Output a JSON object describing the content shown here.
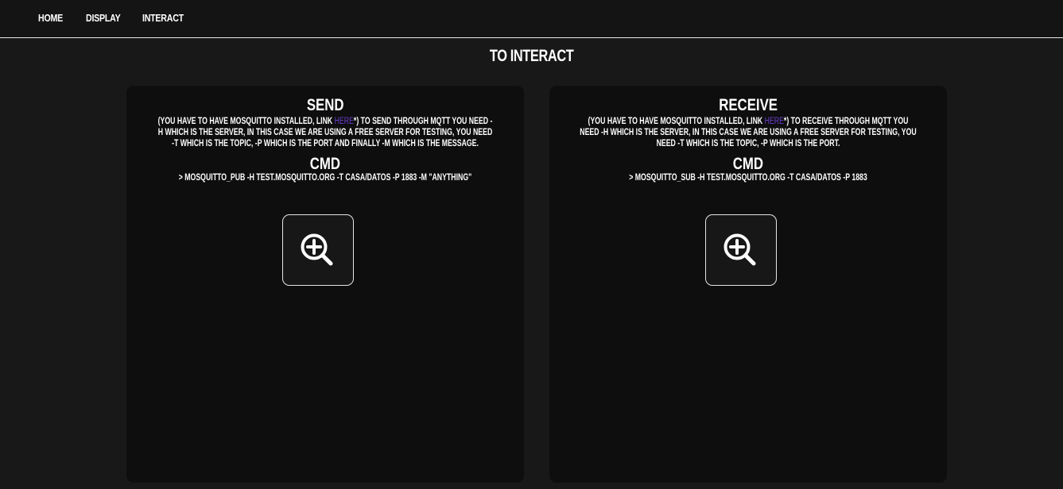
{
  "nav": {
    "items": [
      "HOME",
      "DISPLAY",
      "INTERACT"
    ]
  },
  "page": {
    "title": "TO INTERACT"
  },
  "send": {
    "title": "SEND",
    "desc_before": "(YOU HAVE TO HAVE MOSQUITTO INSTALLED, LINK ",
    "link_label": "HERE",
    "desc_after": "*) TO SEND THROUGH MQTT YOU NEED -H WHICH IS THE SERVER, IN THIS CASE WE ARE USING A FREE SERVER FOR TESTING, YOU NEED -T WHICH IS THE TOPIC, -P WHICH IS THE PORT AND FINALLY -M WHICH IS THE MESSAGE.",
    "cmd_title": "CMD",
    "cmd": "> MOSQUITTO_PUB -H TEST.MOSQUITTO.ORG -T CASA/DATOS -P 1883 -M \"ANYTHING\"",
    "zoom_icon": "zoom-in-icon"
  },
  "receive": {
    "title": "RECEIVE",
    "desc_before": "(YOU HAVE TO HAVE MOSQUITTO INSTALLED, LINK ",
    "link_label": "HERE",
    "desc_after": "*) TO RECEIVE THROUGH MQTT YOU NEED -H WHICH IS THE SERVER, IN THIS CASE WE ARE USING A FREE SERVER FOR TESTING, YOU NEED -T WHICH IS THE TOPIC, -P WHICH IS THE PORT.",
    "cmd_title": "CMD",
    "cmd": "> MOSQUITTO_SUB -H TEST.MOSQUITTO.ORG -T CASA/DATOS -P 1883",
    "zoom_icon": "zoom-in-icon"
  },
  "colors": {
    "background": "#181818",
    "topbar": "#141414",
    "card": "#0e0e0e",
    "link": "#6a3fcf",
    "text": "#ffffff"
  }
}
